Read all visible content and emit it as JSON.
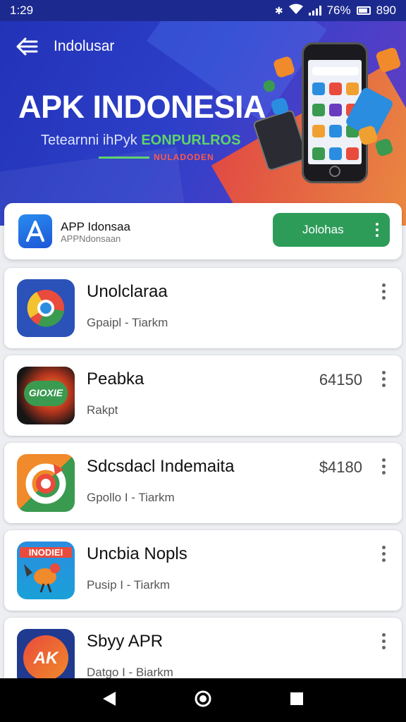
{
  "status_bar": {
    "time": "1:29",
    "battery": "76%",
    "extra": "890"
  },
  "header": {
    "title": "Indolusar",
    "back_icon": "arrow-left-icon"
  },
  "banner": {
    "hero": "APK INDONESIA",
    "tagline_white": "Tetearnni ihPyk",
    "tagline_green": "EONPURLROS",
    "tagline_red": "NULADODEN"
  },
  "featured_app": {
    "name": "APP Idonsaa",
    "subtitle": "APPNdonsaan",
    "button_label": "Jolohas"
  },
  "apps": [
    {
      "title": "Unolclaraa",
      "subtitle": "Gpaipl - Tiarkm",
      "price": ""
    },
    {
      "title": "Peabka",
      "subtitle": "Rakpt",
      "price": "64150"
    },
    {
      "title": "Sdcsdacl  Indemaita",
      "subtitle": "Gpollo I - Tiarkm",
      "price": "$4180"
    },
    {
      "title": "Uncbia Nopls",
      "subtitle": "Pusip I - Tiarkm",
      "price": ""
    },
    {
      "title": "Sbyy APR",
      "subtitle": "Datgo I - Biarkm",
      "price": ""
    }
  ],
  "app_icon_labels": {
    "app2": "GIOXIE",
    "app4": "INODIEI",
    "app5": "AK"
  },
  "colors": {
    "primary": "#2233b8",
    "accent_green": "#2e9c59",
    "accent_orange": "#f29a3a"
  }
}
